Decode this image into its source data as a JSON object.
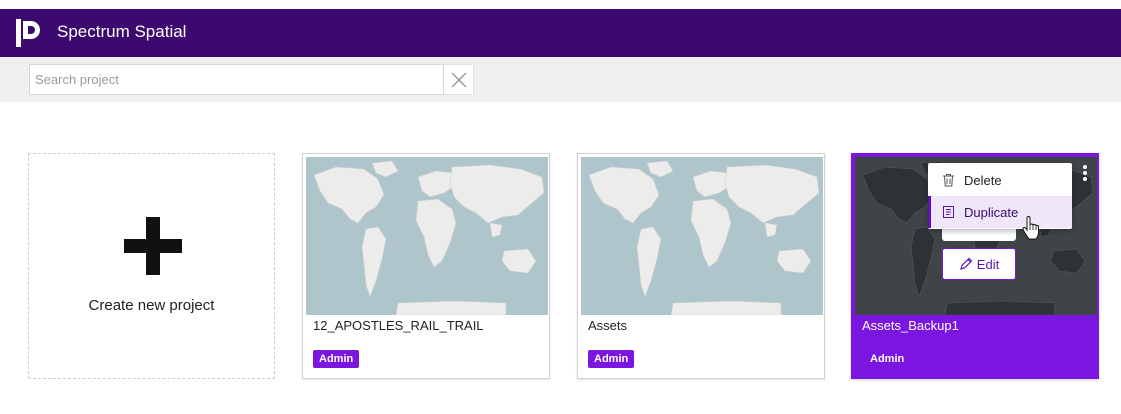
{
  "header": {
    "app_title": "Spectrum Spatial",
    "logo_icon": "brand-logo-icon"
  },
  "search": {
    "placeholder": "Search project",
    "value": ""
  },
  "colors": {
    "header_bg": "#3c0a6e",
    "accent": "#7b16e0",
    "map_ocean": "#aec5cc",
    "map_land": "#ececea"
  },
  "create_card": {
    "label": "Create new project"
  },
  "projects": [
    {
      "name": "12_APOSTLES_RAIL_TRAIL",
      "role": "Admin",
      "selected": false
    },
    {
      "name": "Assets",
      "role": "Admin",
      "selected": false
    },
    {
      "name": "Assets_Backup1",
      "role": "Admin",
      "selected": true
    }
  ],
  "card_actions": {
    "edit_label": "Edit"
  },
  "context_menu": {
    "items": [
      {
        "label": "Delete",
        "icon": "trash-icon"
      },
      {
        "label": "Duplicate",
        "icon": "copy-icon",
        "hovered": true
      }
    ]
  }
}
